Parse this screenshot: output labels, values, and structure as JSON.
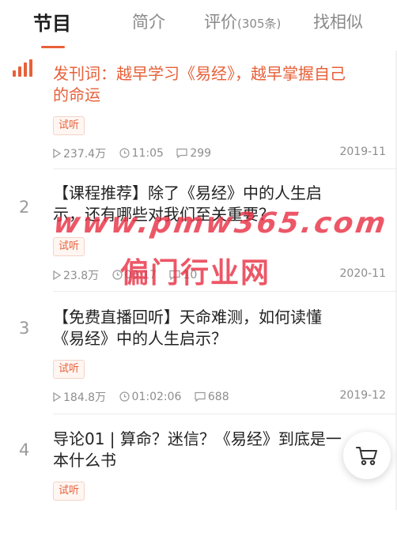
{
  "tabs": [
    {
      "label": "节目",
      "sub": ""
    },
    {
      "label": "简介",
      "sub": ""
    },
    {
      "label": "评价",
      "sub": "(305条)"
    },
    {
      "label": "找相似",
      "sub": ""
    }
  ],
  "episodes": [
    {
      "index": "",
      "title": "发刊词：越早学习《易经》，越早掌握自己的命运",
      "badge": "试听",
      "plays": "237.4万",
      "duration": "11:05",
      "comments": "299",
      "date": "2019-11"
    },
    {
      "index": "2",
      "title": "【课程推荐】除了《易经》中的人生启示，还有哪些对我们至关重要？",
      "badge": "试听",
      "plays": "23.8万",
      "duration": "03:17",
      "comments": "10",
      "date": "2020-11"
    },
    {
      "index": "3",
      "title": "【免费直播回听】天命难测，如何读懂《易经》中的人生启示？",
      "badge": "试听",
      "plays": "184.8万",
      "duration": "01:02:06",
      "comments": "688",
      "date": "2019-12"
    },
    {
      "index": "4",
      "title": "导论01 | 算命？迷信？《易经》到底是一本什么书",
      "badge": "试听"
    }
  ],
  "watermark": {
    "line1": "www.pmw365.com",
    "line2": "偏门行业网"
  },
  "icons": {
    "playing": "playing-bars-icon",
    "plays": "play-count-icon",
    "duration": "clock-icon",
    "comments": "comment-icon",
    "cart": "cart-icon"
  },
  "colors": {
    "accent": "#e8603a",
    "text": "#222222",
    "muted": "#8d8d8d",
    "watermark": "#e83246"
  }
}
